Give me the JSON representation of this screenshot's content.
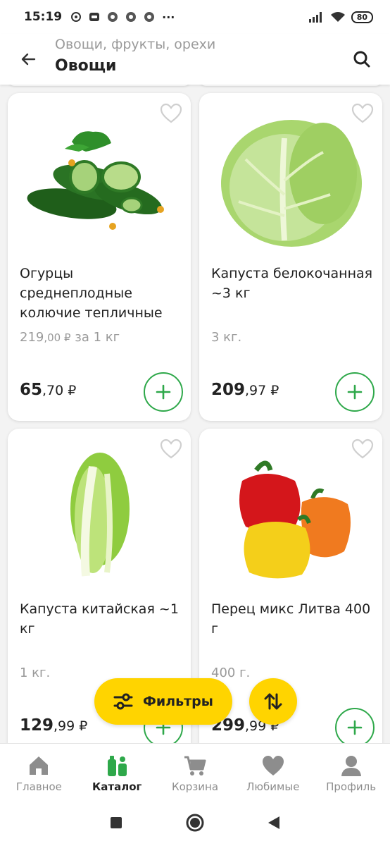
{
  "status_bar": {
    "time": "15:19",
    "battery": "80",
    "more": "···"
  },
  "header": {
    "breadcrumb": "Овощи, фрукты, орехи",
    "title": "Овощи"
  },
  "products": [
    {
      "name": "Огурцы среднеплодные колючие тепличные",
      "unit_int": "219",
      "unit_dec": ",00 ₽",
      "unit_suffix": " за 1 кг",
      "price_int": "65",
      "price_dec": ",70 ₽",
      "image": "cucumbers"
    },
    {
      "name": "Капуста белокочанная ~3 кг",
      "unit_int": "3 кг.",
      "unit_dec": "",
      "unit_suffix": "",
      "price_int": "209",
      "price_dec": ",97 ₽",
      "image": "cabbage"
    },
    {
      "name": "Капуста китайская ~1 кг",
      "unit_int": "1 кг.",
      "unit_dec": "",
      "unit_suffix": "",
      "price_int": "129",
      "price_dec": ",99 ₽",
      "image": "chinese-cabbage"
    },
    {
      "name": "Перец микс Литва 400 г",
      "unit_int": "400 г.",
      "unit_dec": "",
      "unit_suffix": "",
      "price_int": "299",
      "price_dec": ",99 ₽",
      "image": "peppers"
    }
  ],
  "floating": {
    "filters_label": "Фильтры"
  },
  "bottom_nav": [
    {
      "label": "Главное",
      "icon": "home-icon",
      "active": false
    },
    {
      "label": "Каталог",
      "icon": "catalog-icon",
      "active": true
    },
    {
      "label": "Корзина",
      "icon": "cart-icon",
      "active": false
    },
    {
      "label": "Любимые",
      "icon": "heart-icon",
      "active": false
    },
    {
      "label": "Профиль",
      "icon": "profile-icon",
      "active": false
    }
  ],
  "colors": {
    "accent_green": "#2ea84a",
    "accent_yellow": "#ffd400",
    "nav_active_green": "#2ea84a"
  }
}
